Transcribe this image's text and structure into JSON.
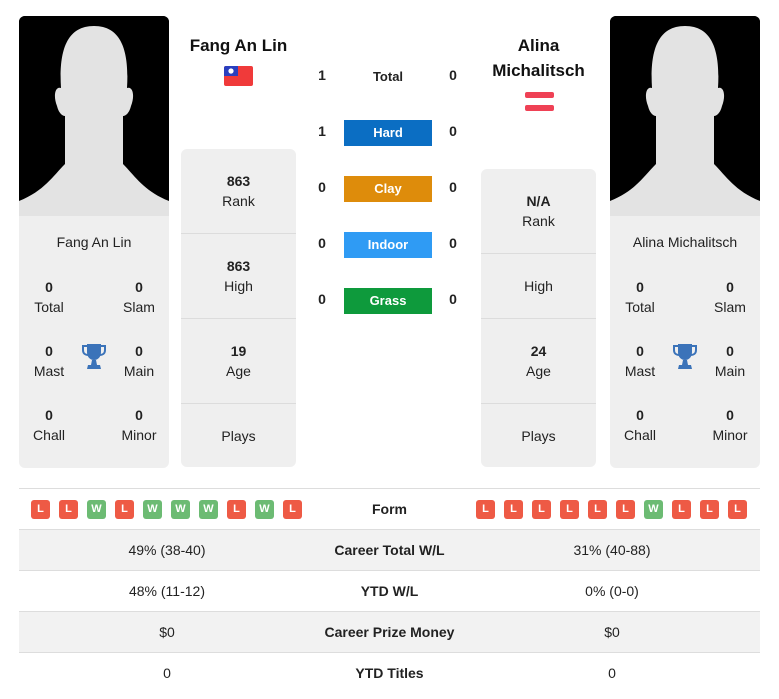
{
  "player1": {
    "name": "Fang An Lin",
    "flag": "taiwan-flag",
    "card_name": "Fang An Lin",
    "titles": {
      "total": {
        "value": "0",
        "label": "Total"
      },
      "slam": {
        "value": "0",
        "label": "Slam"
      },
      "mast": {
        "value": "0",
        "label": "Mast"
      },
      "main": {
        "value": "0",
        "label": "Main"
      },
      "chall": {
        "value": "0",
        "label": "Chall"
      },
      "minor": {
        "value": "0",
        "label": "Minor"
      }
    },
    "rank": {
      "value": "863",
      "label": "Rank"
    },
    "high": {
      "value": "863",
      "label": "High"
    },
    "age": {
      "value": "19",
      "label": "Age"
    },
    "plays": {
      "value": "",
      "label": "Plays"
    },
    "form": [
      "L",
      "L",
      "W",
      "L",
      "W",
      "W",
      "W",
      "L",
      "W",
      "L"
    ]
  },
  "player2": {
    "name": "Alina Michalitsch",
    "name_line1": "Alina",
    "name_line2": "Michalitsch",
    "flag": "austria-flag",
    "card_name": "Alina Michalitsch",
    "titles": {
      "total": {
        "value": "0",
        "label": "Total"
      },
      "slam": {
        "value": "0",
        "label": "Slam"
      },
      "mast": {
        "value": "0",
        "label": "Mast"
      },
      "main": {
        "value": "0",
        "label": "Main"
      },
      "chall": {
        "value": "0",
        "label": "Chall"
      },
      "minor": {
        "value": "0",
        "label": "Minor"
      }
    },
    "rank": {
      "value": "N/A",
      "label": "Rank"
    },
    "high": {
      "value": "",
      "label": "High"
    },
    "age": {
      "value": "24",
      "label": "Age"
    },
    "plays": {
      "value": "",
      "label": "Plays"
    },
    "form": [
      "L",
      "L",
      "L",
      "L",
      "L",
      "L",
      "W",
      "L",
      "L",
      "L"
    ]
  },
  "h2h": [
    {
      "label": "Total",
      "p1": "1",
      "p2": "0",
      "color": null
    },
    {
      "label": "Hard",
      "p1": "1",
      "p2": "0",
      "color": "#0b6ec3"
    },
    {
      "label": "Clay",
      "p1": "0",
      "p2": "0",
      "color": "#de8c0b"
    },
    {
      "label": "Indoor",
      "p1": "0",
      "p2": "0",
      "color": "#2f9bf4"
    },
    {
      "label": "Grass",
      "p1": "0",
      "p2": "0",
      "color": "#0e9a3c"
    }
  ],
  "table": {
    "form_label": "Form",
    "rows": [
      {
        "label": "Career Total W/L",
        "p1": "49% (38-40)",
        "p2": "31% (40-88)"
      },
      {
        "label": "YTD W/L",
        "p1": "48% (11-12)",
        "p2": "0% (0-0)"
      },
      {
        "label": "Career Prize Money",
        "p1": "$0",
        "p2": "$0"
      },
      {
        "label": "YTD Titles",
        "p1": "0",
        "p2": "0"
      }
    ]
  },
  "colors": {
    "loss": "#ee5a45",
    "win": "#6cbb73",
    "trophy": "#3b73b9",
    "panel": "#efefef"
  }
}
